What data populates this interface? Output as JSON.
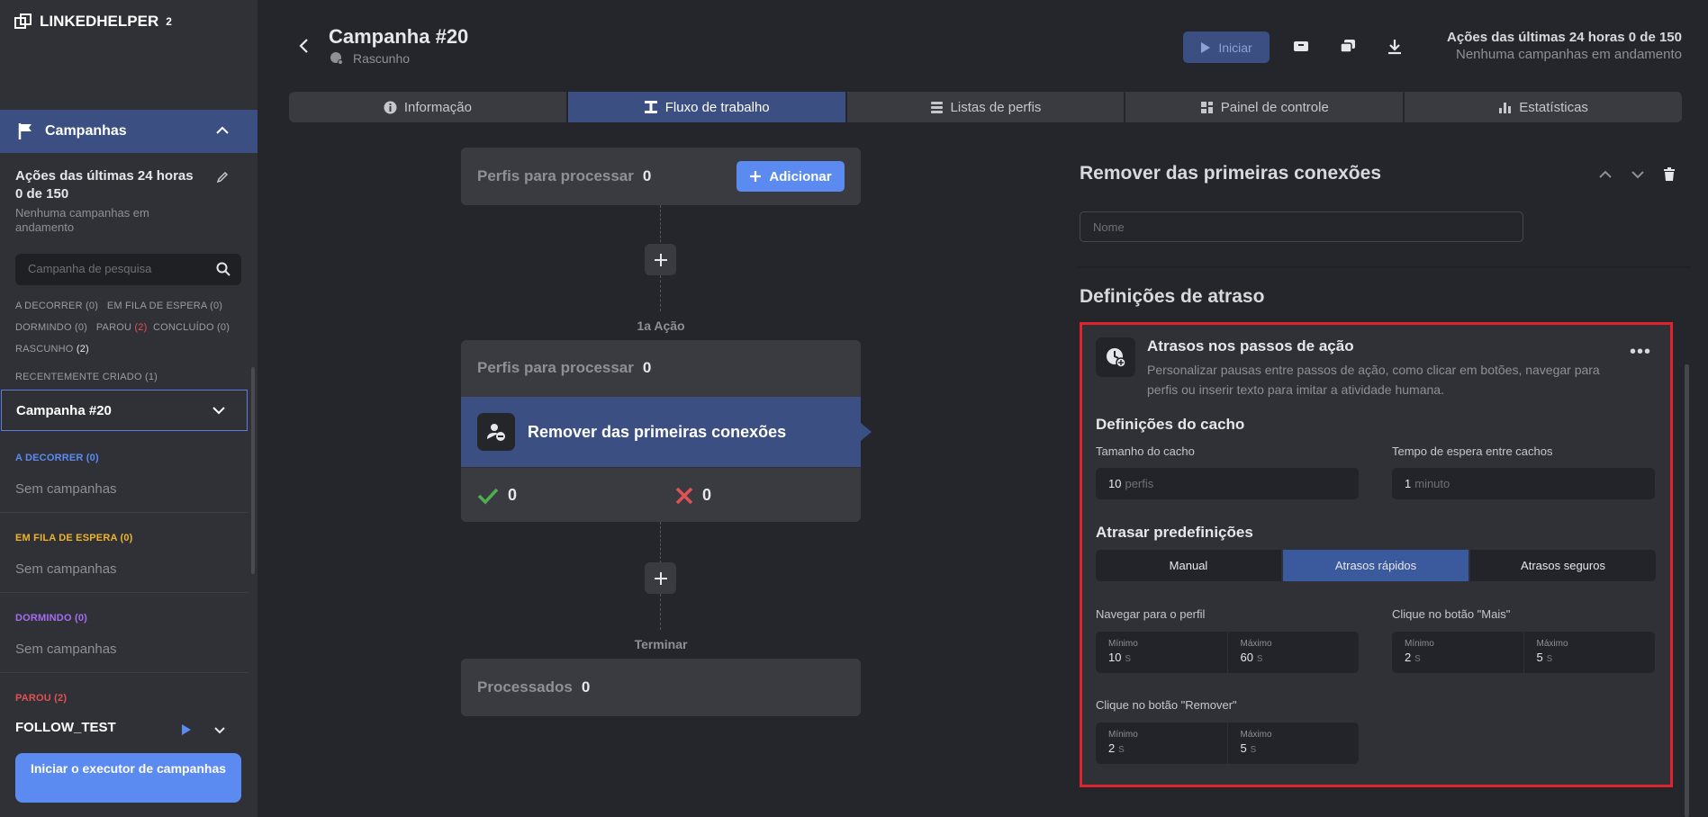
{
  "sidebar": {
    "brand": "LINKEDHELPER",
    "brand_sup": "2",
    "campaigns_label": "Campanhas",
    "stats_title": "Ações das últimas 24 horas 0 de 150",
    "stats_sub": "Nenhuma campanhas em andamento",
    "search_placeholder": "Campanha de pesquisa",
    "filters": {
      "running": "A DECORRER",
      "running_count": "(0)",
      "queued": "EM FILA DE ESPERA",
      "queued_count": "(0)",
      "sleeping": "DORMINDO",
      "sleeping_count": "(0)",
      "stopped": "PAROU",
      "stopped_count": "(2)",
      "done": "CONCLUÍDO",
      "done_count": "(0)",
      "draft": "RASCUNHO",
      "draft_count": "(2)"
    },
    "recent_label": "RECENTEMENTE CRIADO (1)",
    "selected_campaign": "Campanha #20",
    "groups": [
      {
        "label": "A DECORRER (0)",
        "empty": "Sem campanhas",
        "color": "#5b8bf0"
      },
      {
        "label": "EM FILA DE ESPERA (0)",
        "empty": "Sem campanhas",
        "color": "#f0b429"
      },
      {
        "label": "DORMINDO (0)",
        "empty": "Sem campanhas",
        "color": "#a66cf0"
      }
    ],
    "stopped_group": "PAROU (2)",
    "follow_test": "FOLLOW_TEST",
    "start_runner": "Iniciar o executor de campanhas"
  },
  "header": {
    "title": "Campanha #20",
    "status": "Rascunho",
    "start_label": "Iniciar",
    "stats_line1": "Ações das últimas 24 horas 0 de 150",
    "stats_line2": "Nenhuma campanhas em andamento"
  },
  "tabs": [
    {
      "label": "Informação",
      "icon": "info-icon"
    },
    {
      "label": "Fluxo de trabalho",
      "icon": "workflow-icon"
    },
    {
      "label": "Listas de perfis",
      "icon": "list-icon"
    },
    {
      "label": "Painel de controle",
      "icon": "dashboard-icon"
    },
    {
      "label": "Estatísticas",
      "icon": "stats-icon"
    }
  ],
  "workflow": {
    "to_process_label": "Perfis para processar",
    "to_process_count": "0",
    "add_label": "Adicionar",
    "action_label": "1a Ação",
    "step_to_process_label": "Perfis para processar",
    "step_to_process_count": "0",
    "step_name": "Remover das primeiras conexões",
    "success_count": "0",
    "fail_count": "0",
    "end_label": "Terminar",
    "processed_label": "Processados",
    "processed_count": "0"
  },
  "panel": {
    "title": "Remover das primeiras conexões",
    "name_placeholder": "Nome",
    "delay_settings_title": "Definições de atraso",
    "box_title": "Atrasos nos passos de ação",
    "box_desc": "Personalizar pausas entre passos de ação, como clicar em botões, navegar para perfis ou inserir texto para imitar a atividade humana.",
    "batch_title": "Definições do cacho",
    "batch_size_label": "Tamanho do cacho",
    "batch_size_value": "10",
    "batch_size_unit": "perfis",
    "batch_wait_label": "Tempo de espera entre cachos",
    "batch_wait_value": "1",
    "batch_wait_unit": "minuto",
    "presets_title": "Atrasar predefinições",
    "presets": [
      "Manual",
      "Atrasos rápidos",
      "Atrasos seguros"
    ],
    "active_preset": "Atrasos rápidos",
    "min_label": "Mínimo",
    "max_label": "Máximo",
    "unit": "s",
    "delays": [
      {
        "label": "Navegar para o perfil",
        "min": "10",
        "max": "60"
      },
      {
        "label": "Clique no botão \"Mais\"",
        "min": "2",
        "max": "5"
      },
      {
        "label": "Clique no botão \"Remover\"",
        "min": "2",
        "max": "5"
      }
    ]
  },
  "colors": {
    "accent": "#5b8bf0",
    "active": "#3b4f82",
    "highlight_border": "#e0242e",
    "success": "#4caf50",
    "danger": "#e05252"
  }
}
